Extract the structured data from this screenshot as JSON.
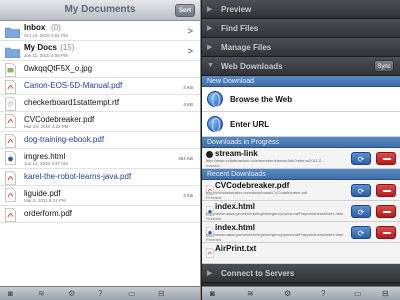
{
  "left": {
    "title": "My Documents",
    "sort_label": "Sort",
    "files": [
      {
        "kind": "folder",
        "name": "Inbox",
        "count": "(0)",
        "date": "Oct 12, 2010 4:51 PM",
        "chevron": ">"
      },
      {
        "kind": "folder",
        "name": "My Docs",
        "count": "(15)",
        "date": "Jun 11, 2010 4:56 PM",
        "chevron": ">"
      },
      {
        "kind": "image",
        "name": "0wkqqQtF5X_o.jpg",
        "size": "",
        "date": ""
      },
      {
        "kind": "pdf",
        "name": "Canon-EOS-5D-Manual.pdf",
        "size": "4 KB",
        "date": "",
        "link": true
      },
      {
        "kind": "doc",
        "name": "checkerboard1stattempt.rtf",
        "size": "4 KB",
        "date": ""
      },
      {
        "kind": "pdf",
        "name": "CVCodebreaker.pdf",
        "size": "",
        "date": "Mar 24, 2010 4:22 PM"
      },
      {
        "kind": "pdf",
        "name": "dog-training-ebook.pdf",
        "size": "",
        "date": "",
        "link": true
      },
      {
        "kind": "html",
        "name": "imgres.html",
        "size": "364 KB",
        "date": "Jun 12, 2010 4:37 AM"
      },
      {
        "kind": "pdf",
        "name": "karel-the-robot-learns-java.pdf",
        "size": "",
        "date": "",
        "link": true
      },
      {
        "kind": "pdf",
        "name": "liguide.pdf",
        "size": "2 KB",
        "date": "Mar 6, 2011 6:21 PM"
      },
      {
        "kind": "pdf",
        "name": "orderform.pdf",
        "size": "",
        "date": ""
      }
    ]
  },
  "right": {
    "sections_top": [
      {
        "title": "Preview",
        "arrow": "▶"
      },
      {
        "title": "Find Files",
        "arrow": "▶"
      },
      {
        "title": "Manage Files",
        "arrow": "▶"
      },
      {
        "title": "Web Downloads",
        "arrow": "▼",
        "button": "Sync"
      }
    ],
    "new_download": {
      "header": "New Download",
      "actions": [
        {
          "label": "Browse the Web"
        },
        {
          "label": "Enter URL"
        }
      ]
    },
    "in_progress": {
      "header": "Downloads in Progress",
      "items": [
        {
          "name": "stream-link",
          "url": "http://www.coastfoaction.com/member/stream-link?returnu2011-0...",
          "state": "Inactive"
        }
      ]
    },
    "recent": {
      "header": "Recent Downloads",
      "items": [
        {
          "kind": "pdf",
          "name": "CVCodebreaker.pdf",
          "url": "http://cvcodebreaker.com/downloads/CVCodebreaker.pdf",
          "state": "Finished"
        },
        {
          "kind": "html",
          "name": "index.html",
          "url": "http://www.nasa.gov/centers/hq/emergency/personalPreparedness/index.html",
          "state": "Finished"
        },
        {
          "kind": "html",
          "name": "index.html",
          "url": "http://www.nasa.gov/centers/hq/emergency/personalPreparedness/index.html",
          "state": "Finished"
        },
        {
          "kind": "pdf",
          "name": "AirPrint.txt",
          "url": "",
          "state": ""
        }
      ]
    },
    "sections_bottom": [
      {
        "title": "Connect to Servers",
        "arrow": "▶"
      }
    ],
    "retry_glyph": "⟳"
  },
  "colors": {
    "accent_blue": "#3f6ea8",
    "delete_red": "#b31d1d",
    "pdf_red": "#d23a2f",
    "folder_blue": "#7aa7df"
  }
}
